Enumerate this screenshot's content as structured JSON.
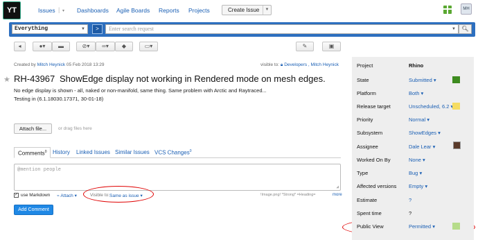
{
  "app": {
    "logo": "YT"
  },
  "nav": {
    "issues": "Issues",
    "dashboards": "Dashboards",
    "agile": "Agile Boards",
    "reports": "Reports",
    "projects": "Projects",
    "create": "Create Issue",
    "user_initials": "MH"
  },
  "search": {
    "context": "Everything",
    "placeholder": "Enter search request"
  },
  "toolbar": {
    "icons": [
      "arrow-left-icon",
      "user-icon",
      "comment-icon",
      "tag-icon",
      "link-icon",
      "label-icon",
      "window-icon",
      "edit-icon",
      "print-icon"
    ]
  },
  "issue": {
    "created_by_label": "Created by",
    "author": "Mitch Heynick",
    "created_at": "05 Feb 2018 13:29",
    "visible_to_label": "visible to:",
    "visible_to": "Developers , Mitch Heynick",
    "id": "RH-43967",
    "summary": "ShowEdge display not working in Rendered mode on mesh edges.",
    "description_line1": "No edge display is shown - all, naked or non-manifold, same thing. Same problem with Arctic and Raytraced...",
    "description_line2": "Testing in (6.1.18030.17371, 30-01-18)",
    "attach_button": "Attach file...",
    "drag_hint": "or drag files here"
  },
  "tabs": {
    "comments": "Comments",
    "comments_count": "0",
    "history": "History",
    "linked": "Linked Issues",
    "similar": "Similar Issues",
    "vcs": "VCS Changes",
    "vcs_count": "0"
  },
  "comment": {
    "placeholder": "@mention people",
    "markdown_label": "use Markdown",
    "attach": "Attach",
    "visible_to_label": "Visible to:",
    "visible_to_value": "Same as issue",
    "hints": "!Image.png! *Strong* =Heading=",
    "more": "more",
    "add_button": "Add Comment"
  },
  "fields": [
    {
      "label": "Project",
      "value": "Rhino"
    },
    {
      "label": "State",
      "value": "Submitted",
      "color": "#3d8b1f"
    },
    {
      "label": "Platform",
      "value": "Both"
    },
    {
      "label": "Release target",
      "value": "Unscheduled, 6.2",
      "color": "#f5dc63"
    },
    {
      "label": "Priority",
      "value": "Normal"
    },
    {
      "label": "Subsystem",
      "value": "ShowEdges"
    },
    {
      "label": "Assignee",
      "value": "Dale Lear"
    },
    {
      "label": "Worked On By",
      "value": "None"
    },
    {
      "label": "Type",
      "value": "Bug"
    },
    {
      "label": "Affected versions",
      "value": "Empty"
    },
    {
      "label": "Estimate",
      "value": "?"
    },
    {
      "label": "Spent time",
      "value": "?"
    },
    {
      "label": "Public View",
      "value": "Permitted",
      "color": "#b6dc8a"
    }
  ],
  "colors": {
    "accent": "#2d6fbf",
    "annotation": "#e00000"
  }
}
